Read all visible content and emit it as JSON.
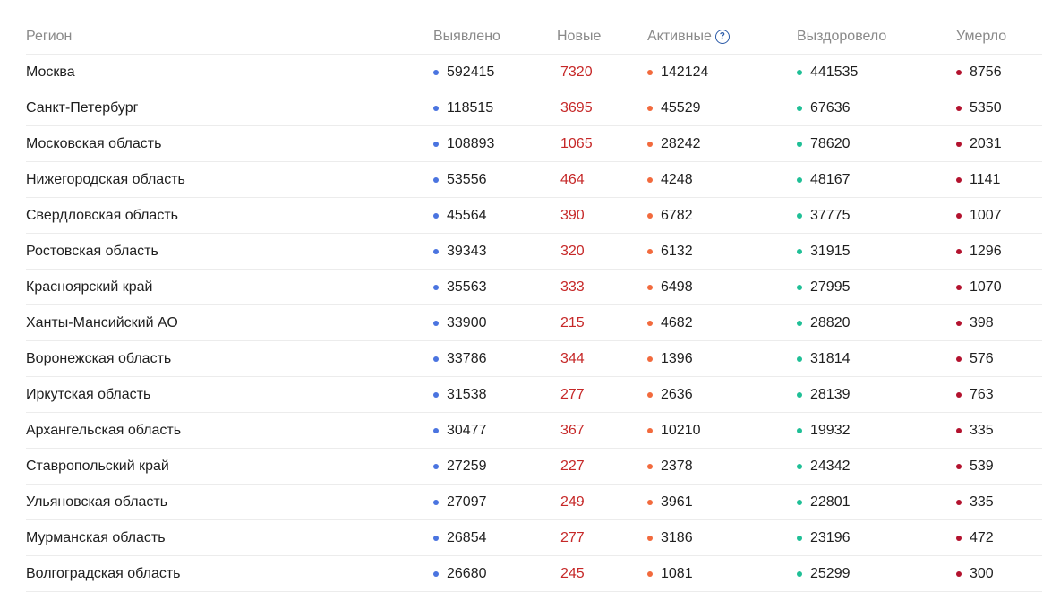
{
  "colors": {
    "found_dot": "#4a74e0",
    "new_text": "#c62828",
    "active_dot": "#f26a3d",
    "recovered_dot": "#1fbf96",
    "died_dot": "#b3122e",
    "header_text": "#8a8a8a",
    "help_icon": "#2c5ba8"
  },
  "header": {
    "region": "Регион",
    "found": "Выявлено",
    "new": "Новые",
    "active": "Активные",
    "active_help_icon": "question-circle-icon",
    "active_help_glyph": "?",
    "recovered": "Выздоровело",
    "died": "Умерло"
  },
  "rows": [
    {
      "region": "Москва",
      "found": "592415",
      "new": "7320",
      "active": "142124",
      "recovered": "441535",
      "died": "8756"
    },
    {
      "region": "Санкт-Петербург",
      "found": "118515",
      "new": "3695",
      "active": "45529",
      "recovered": "67636",
      "died": "5350"
    },
    {
      "region": "Московская область",
      "found": "108893",
      "new": "1065",
      "active": "28242",
      "recovered": "78620",
      "died": "2031"
    },
    {
      "region": "Нижегородская область",
      "found": "53556",
      "new": "464",
      "active": "4248",
      "recovered": "48167",
      "died": "1141"
    },
    {
      "region": "Свердловская область",
      "found": "45564",
      "new": "390",
      "active": "6782",
      "recovered": "37775",
      "died": "1007"
    },
    {
      "region": "Ростовская область",
      "found": "39343",
      "new": "320",
      "active": "6132",
      "recovered": "31915",
      "died": "1296"
    },
    {
      "region": "Красноярский край",
      "found": "35563",
      "new": "333",
      "active": "6498",
      "recovered": "27995",
      "died": "1070"
    },
    {
      "region": "Ханты-Мансийский АО",
      "found": "33900",
      "new": "215",
      "active": "4682",
      "recovered": "28820",
      "died": "398"
    },
    {
      "region": "Воронежская область",
      "found": "33786",
      "new": "344",
      "active": "1396",
      "recovered": "31814",
      "died": "576"
    },
    {
      "region": "Иркутская область",
      "found": "31538",
      "new": "277",
      "active": "2636",
      "recovered": "28139",
      "died": "763"
    },
    {
      "region": "Архангельская область",
      "found": "30477",
      "new": "367",
      "active": "10210",
      "recovered": "19932",
      "died": "335"
    },
    {
      "region": "Ставропольский край",
      "found": "27259",
      "new": "227",
      "active": "2378",
      "recovered": "24342",
      "died": "539"
    },
    {
      "region": "Ульяновская область",
      "found": "27097",
      "new": "249",
      "active": "3961",
      "recovered": "22801",
      "died": "335"
    },
    {
      "region": "Мурманская область",
      "found": "26854",
      "new": "277",
      "active": "3186",
      "recovered": "23196",
      "died": "472"
    },
    {
      "region": "Волгоградская область",
      "found": "26680",
      "new": "245",
      "active": "1081",
      "recovered": "25299",
      "died": "300"
    }
  ]
}
